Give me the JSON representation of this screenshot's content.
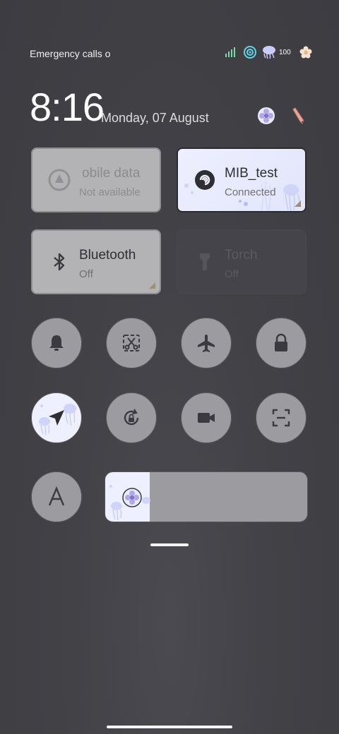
{
  "status_bar": {
    "carrier_text": "Emergency calls o",
    "battery": "100",
    "icons": [
      "signal-icon",
      "wifi-icon",
      "battery-icon",
      "flower-icon"
    ]
  },
  "header": {
    "time": "8:16",
    "date": "Monday, 07 August",
    "theme_icon": "theme-flower-icon",
    "edit_icon": "edit-pencil-icon"
  },
  "tiles": {
    "mobile_data": {
      "title": "obile data",
      "subtitle": "Not available",
      "icon": "mobile-data-icon",
      "enabled": false
    },
    "wifi": {
      "title": "MIB_test",
      "subtitle": "Connected",
      "icon": "wifi-icon",
      "active": true
    },
    "bluetooth": {
      "title": "Bluetooth",
      "subtitle": "Off",
      "icon": "bluetooth-icon",
      "active": false
    },
    "torch": {
      "title": "Torch",
      "subtitle": "Off",
      "icon": "torch-icon",
      "enabled": false
    }
  },
  "toggles": [
    {
      "name": "sound",
      "icon": "bell-icon",
      "active": false
    },
    {
      "name": "screenshot",
      "icon": "scissors-icon",
      "active": false
    },
    {
      "name": "airplane-mode",
      "icon": "airplane-icon",
      "active": false
    },
    {
      "name": "lock",
      "icon": "lock-icon",
      "active": false
    },
    {
      "name": "location",
      "icon": "location-arrow-icon",
      "active": true
    },
    {
      "name": "auto-rotate",
      "icon": "rotate-lock-icon",
      "active": false
    },
    {
      "name": "screen-record",
      "icon": "video-camera-icon",
      "active": false
    },
    {
      "name": "scanner",
      "icon": "scan-icon",
      "active": false
    },
    {
      "name": "auto-brightness",
      "icon": "letter-a-icon",
      "active": false
    }
  ],
  "brightness": {
    "level": 0.22,
    "icon": "brightness-flower-icon"
  },
  "colors": {
    "accent": "#eef0ff",
    "tile_inactive": "#b3b3b5",
    "button": "#9c9ca0",
    "background": "#414146"
  }
}
